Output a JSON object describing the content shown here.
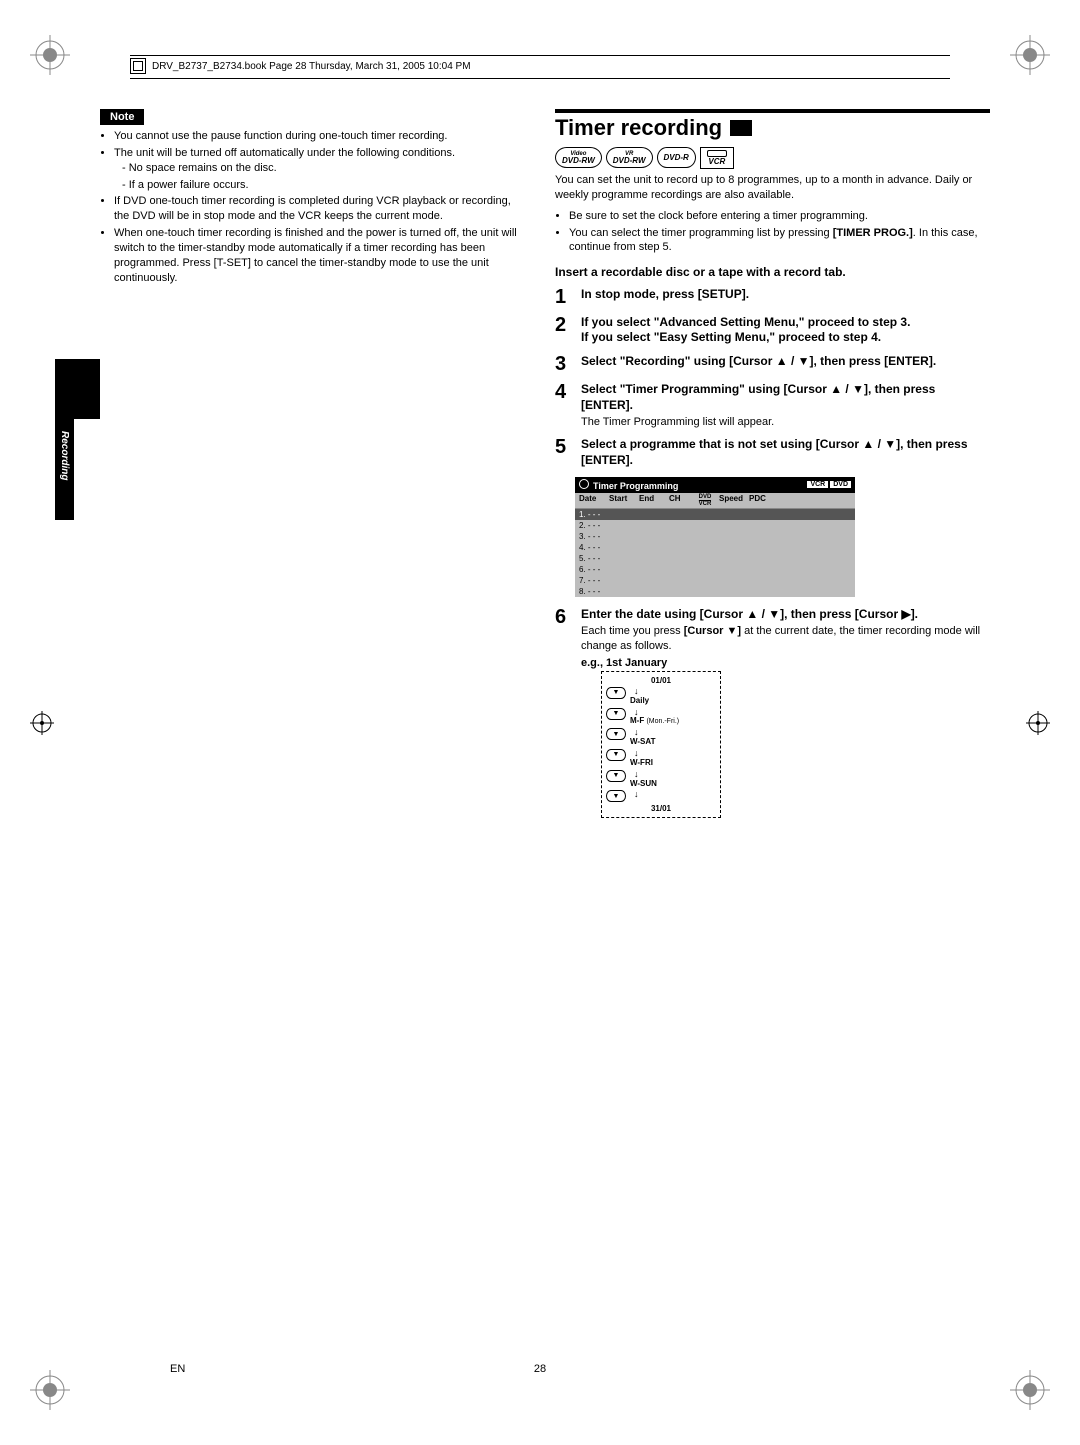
{
  "book_header": "DRV_B2737_B2734.book  Page 28  Thursday, March 31, 2005  10:04 PM",
  "side_tab": "Recording",
  "left": {
    "note_label": "Note",
    "bullets": [
      "You cannot use the pause function during one-touch timer recording.",
      "The unit will be turned off automatically under the following conditions.",
      "If DVD one-touch timer recording is completed during VCR playback or recording, the DVD will be in stop mode and the VCR keeps the current mode.",
      "When one-touch timer recording is finished and the power is turned off, the unit will switch to the timer-standby mode automatically if a timer recording has been programmed. Press [T-SET] to cancel the timer-standby mode to use the unit continuously."
    ],
    "sub_bullets": [
      "No space remains on the disc.",
      "If a power failure occurs."
    ]
  },
  "right": {
    "section_title": "Timer recording",
    "badges": {
      "b1_top": "Video",
      "b1_main": "DVD-RW",
      "b2_top": "VR",
      "b2_main": "DVD-RW",
      "b3_main": "DVD-R",
      "b4_main": "VCR"
    },
    "intro": "You can set the unit to record up to 8 programmes, up to a month in advance. Daily or weekly programme recordings are also available.",
    "intro_bullets": [
      "Be sure to set the clock before entering a timer programming.",
      "You can select the timer programming list by pressing [TIMER PROG.]. In this case, continue from step 5."
    ],
    "prelim": "Insert a recordable disc or a tape with a record tab.",
    "steps": {
      "s1": "In stop mode, press [SETUP].",
      "s2a": "If you select \"Advanced Setting Menu,\" proceed to step 3.",
      "s2b": "If you select \"Easy Setting Menu,\" proceed to step 4.",
      "s3": "Select \"Recording\" using [Cursor ▲ / ▼], then press [ENTER].",
      "s4": "Select \"Timer Programming\" using [Cursor ▲ / ▼], then press [ENTER].",
      "s4_sub": "The Timer Programming list will appear.",
      "s5": "Select a programme that is not set using [Cursor ▲ / ▼], then press [ENTER].",
      "s6": "Enter the date using [Cursor ▲ / ▼], then press [Cursor ▶].",
      "s6_sub": "Each time you press [Cursor ▼] at the current date, the timer recording mode will change as follows.",
      "s6_eg": "e.g., 1st January"
    },
    "timer_table": {
      "title": "Timer Programming",
      "tags": [
        "VCR",
        "DVD"
      ],
      "headers": [
        "Date",
        "Start",
        "End",
        "CH",
        "DVD VCR",
        "Speed",
        "PDC"
      ],
      "rows": [
        "1. - - -",
        "2. - - -",
        "3. - - -",
        "4. - - -",
        "5. - - -",
        "6. - - -",
        "7. - - -",
        "8. - - -"
      ]
    },
    "cycle": {
      "top": "01/01",
      "items": [
        "Daily",
        "M-F",
        "W-SAT",
        "W-FRI",
        "W-SUN"
      ],
      "mf_note": "(Mon.-Fri.)",
      "bottom": "31/01"
    }
  },
  "footer": {
    "en": "EN",
    "page": "28"
  }
}
